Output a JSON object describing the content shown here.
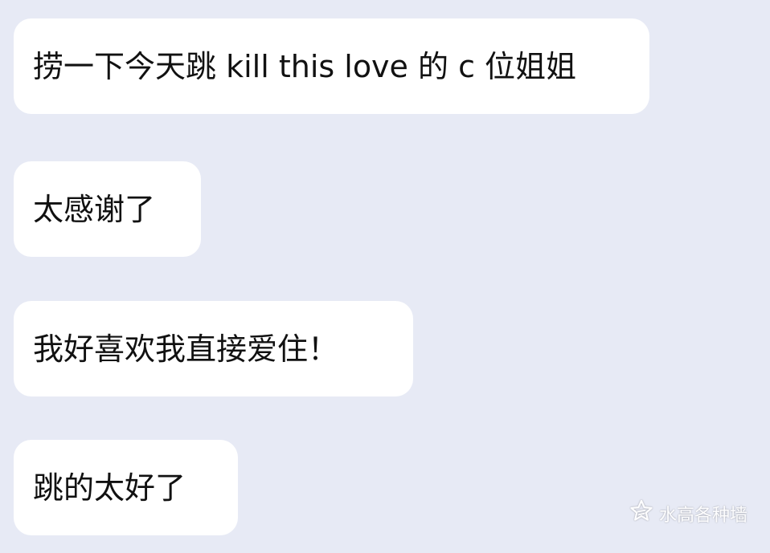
{
  "messages": [
    {
      "text": "捞一下今天跳 kill this love 的 c 位姐姐"
    },
    {
      "text": "太感谢了"
    },
    {
      "text": "我好喜欢我直接爱住！"
    },
    {
      "text": "跳的太好了"
    }
  ],
  "watermark": {
    "icon": "weibo-star-icon",
    "text": "水高各种墙"
  },
  "colors": {
    "background": "#e7eaf5",
    "bubble": "#ffffff",
    "text": "#111111"
  }
}
